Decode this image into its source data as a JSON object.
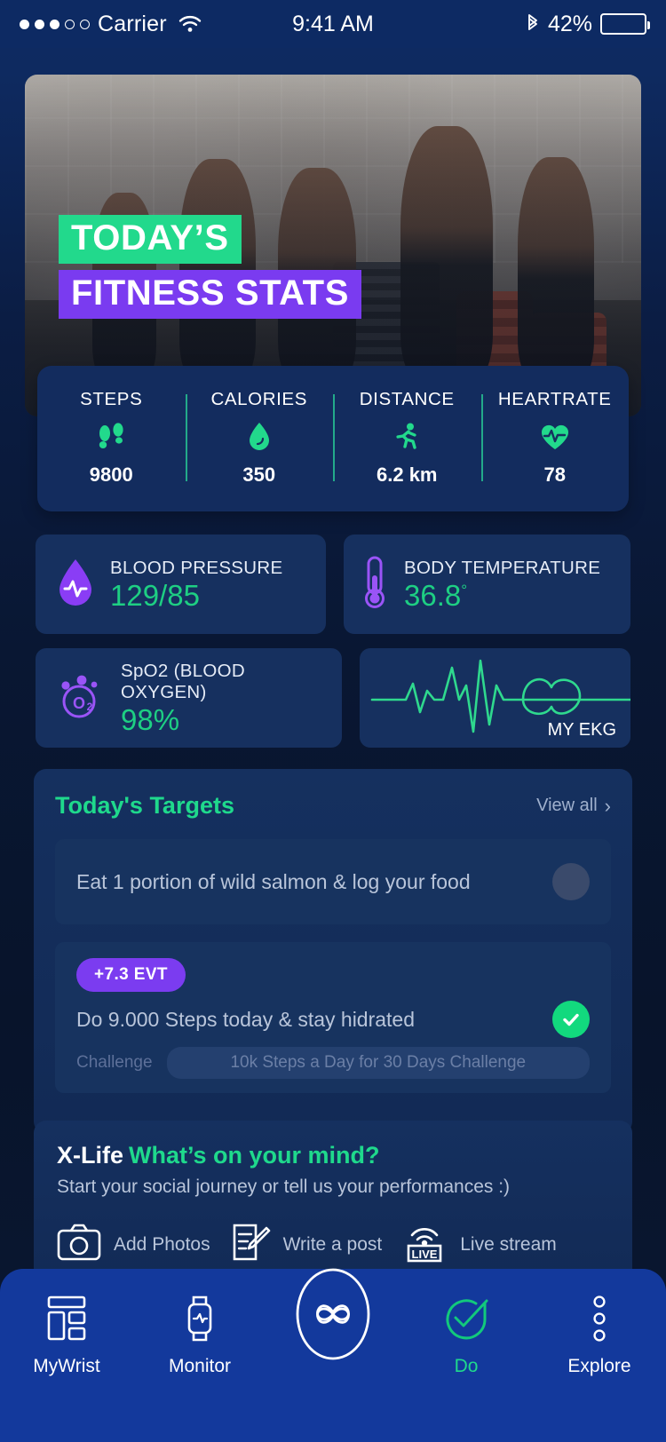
{
  "status_bar": {
    "signal_dots_filled": 3,
    "signal_dots_total": 5,
    "carrier": "Carrier",
    "wifi_icon": "wifi-icon",
    "time": "9:41 AM",
    "bluetooth_icon": "bluetooth-icon",
    "battery_percent": "42%",
    "battery_level": 42
  },
  "hero": {
    "line1": "TODAY’S",
    "line2": "FITNESS STATS",
    "green": "#22d98c",
    "purple": "#7a3bf0"
  },
  "stats": [
    {
      "label": "STEPS",
      "icon": "footprints-icon",
      "value": "9800"
    },
    {
      "label": "CALORIES",
      "icon": "flame-drop-icon",
      "value": "350"
    },
    {
      "label": "DISTANCE",
      "icon": "runner-icon",
      "value": "6.2 km"
    },
    {
      "label": "HEARTRATE",
      "icon": "heart-pulse-icon",
      "value": "78"
    }
  ],
  "vitals": {
    "blood_pressure": {
      "label": "BLOOD PRESSURE",
      "value": "129/85",
      "icon": "blood-drop-pulse-icon"
    },
    "body_temperature": {
      "label": "BODY TEMPERATURE",
      "value": "36.8",
      "unit": "°",
      "icon": "thermometer-icon"
    },
    "spo2": {
      "label": "SpO2 (BLOOD OXYGEN)",
      "value": "98%",
      "icon": "o2-bubble-icon"
    },
    "ekg": {
      "label": "MY EKG",
      "icon": "ekg-wave-icon"
    }
  },
  "targets": {
    "title": "Today's Targets",
    "view_all": "View all",
    "chevron": "›",
    "items": [
      {
        "text": "Eat 1 portion of wild salmon & log your food",
        "completed": false
      },
      {
        "badge": "+7.3  EVT",
        "text": "Do 9.000 Steps today & stay hidrated",
        "completed": true,
        "challenge_label": "Challenge",
        "challenge_name": "10k Steps a Day for 30 Days Challenge"
      }
    ]
  },
  "xlife": {
    "brand": "X-Life",
    "question": "What’s on your mind?",
    "subtitle": "Start your social journey or tell us your performances :)",
    "actions": [
      {
        "icon": "camera-icon",
        "label": "Add Photos"
      },
      {
        "icon": "write-post-icon",
        "label": "Write a post"
      },
      {
        "icon": "live-stream-icon",
        "label": "Live stream"
      }
    ]
  },
  "bottom_nav": {
    "items": [
      {
        "label": "MyWrist",
        "icon": "dashboard-grid-icon",
        "active": false
      },
      {
        "label": "Monitor",
        "icon": "smartwatch-icon",
        "active": false
      },
      {
        "label": "",
        "icon": "app-logo-icon",
        "active": false
      },
      {
        "label": "Do",
        "icon": "check-circle-icon",
        "active": true
      },
      {
        "label": "Explore",
        "icon": "more-dots-icon",
        "active": false
      }
    ],
    "active_color": "#1fd98c"
  }
}
